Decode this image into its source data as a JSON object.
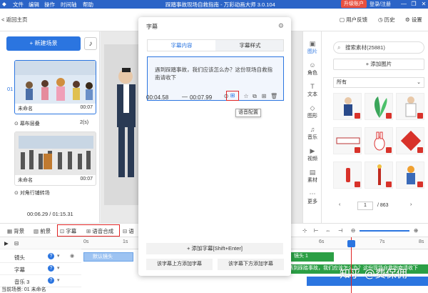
{
  "titlebar": {
    "menu": [
      "文件",
      "编辑",
      "操作",
      "时间轴",
      "帮助"
    ],
    "title": "踩踏事故现场自救指南 - 万彩动画大师 3.0.104",
    "upgrade": "升级账户",
    "login": "登录/注册",
    "win": [
      "—",
      "❐",
      "✕"
    ]
  },
  "topbar": {
    "back": "< 返回主页",
    "feedback": "用户反馈",
    "history": "历史",
    "settings": "设置"
  },
  "leftpanel": {
    "new_scene": "+ 新建场景",
    "scenes": [
      {
        "index": "01",
        "name": "未命名",
        "duration": "00:07"
      },
      {
        "index": "",
        "name": "未命名",
        "duration": "00:07"
      }
    ],
    "transitions": [
      {
        "label": "幕布层叠",
        "duration": "2(s)"
      },
      {
        "label": "对角行铺转场",
        "duration": "2(s)"
      }
    ],
    "time_current": "00:06.29",
    "time_total": "/ 01:15.31"
  },
  "dialog": {
    "title": "字幕",
    "tabs": [
      "字幕内容",
      "字幕样式"
    ],
    "subtitle_text": "遇到踩踏事故，我们应该怎么办？这份现场自救指南请收下",
    "start": "00:04.58",
    "dash": "—",
    "end": "00:07.99",
    "tooltip": "语音配置",
    "add_subtitle": "+ 添加字幕[Shift+Enter]",
    "add_above": "该字幕上方添加字幕",
    "add_below": "该字幕下方添加字幕"
  },
  "sidecol": [
    {
      "label": "图片",
      "icon": "▣"
    },
    {
      "label": "角色",
      "icon": "☺"
    },
    {
      "label": "文本",
      "icon": "T"
    },
    {
      "label": "图形",
      "icon": "◇"
    },
    {
      "label": "音乐",
      "icon": "♫"
    },
    {
      "label": "视频",
      "icon": "▶"
    },
    {
      "label": "素材",
      "icon": "▤"
    },
    {
      "label": "更多",
      "icon": "⋯"
    }
  ],
  "rightpanel": {
    "search_placeholder": "搜索素材(25881)",
    "add_image": "+ 添加图片",
    "filter": "所有",
    "page": "1",
    "total": "/ 863"
  },
  "toolrow": {
    "items": [
      "背景",
      "前景",
      "字幕",
      "语音合成",
      "语"
    ]
  },
  "timeline": {
    "ruler": [
      "0s",
      "1s",
      "2s",
      "3s",
      "4s",
      "5s",
      "6s",
      "7s",
      "8s"
    ],
    "tracks": [
      {
        "label": "镜头"
      },
      {
        "label": "字幕"
      },
      {
        "label": "音乐 3"
      }
    ],
    "camera_clip": "默认镜头",
    "camera_clip2": "镜头 1",
    "subtitle_clip": "遇到踩踏事故，我们应该怎么办？这份现场自救指南请收下",
    "status": "当前场景: 01   未命名",
    "watermark": "知乎 @费保佣"
  },
  "colors": {
    "accent": "#2b75e0",
    "titlebar": "#2b64c7",
    "highlight_red": "#e02424",
    "clip_green": "#2b9f45"
  }
}
